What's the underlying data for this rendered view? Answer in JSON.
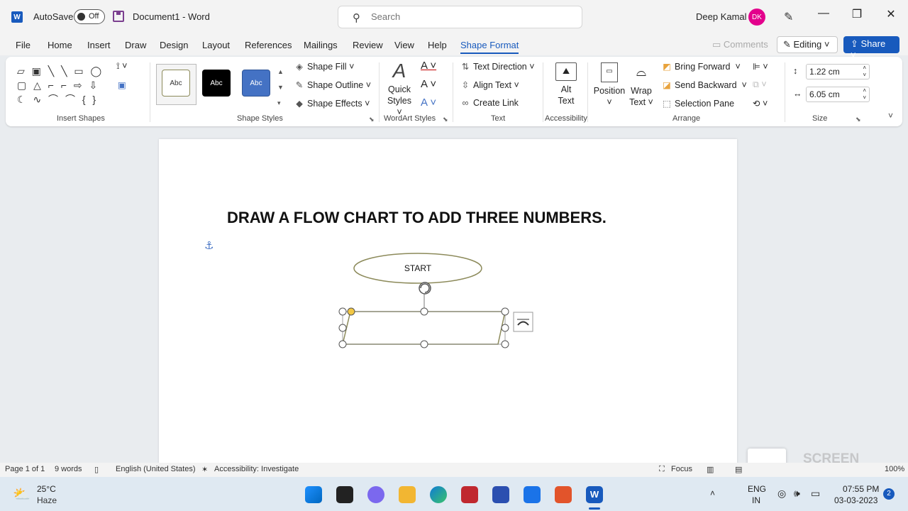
{
  "titlebar": {
    "logo": "W",
    "autosave_label": "AutoSave",
    "autosave_state": "Off",
    "doc_title": "Document1  -  Word",
    "search_placeholder": "Search",
    "user_name": "Deep Kamal",
    "user_initials": "DK",
    "minimize": "—",
    "restore": "❐",
    "close": "✕"
  },
  "tabs": [
    "File",
    "Home",
    "Insert",
    "Draw",
    "Design",
    "Layout",
    "References",
    "Mailings",
    "Review",
    "View",
    "Help",
    "Shape Format"
  ],
  "actions": {
    "comments": "Comments",
    "editing": "Editing",
    "share": "Share"
  },
  "ribbon": {
    "groups": {
      "insert_shapes": "Insert Shapes",
      "shape_styles": "Shape Styles",
      "wordart_styles": "WordArt Styles",
      "text": "Text",
      "accessibility": "Accessibility",
      "arrange": "Arrange",
      "size": "Size"
    },
    "style_presets": [
      "Abc",
      "Abc",
      "Abc"
    ],
    "shape_fill": "Shape Fill",
    "shape_outline": "Shape Outline",
    "shape_effects": "Shape Effects",
    "quick_styles_1": "Quick",
    "quick_styles_2": "Styles",
    "text_direction": "Text Direction",
    "align_text": "Align Text",
    "create_link": "Create Link",
    "alt_text_1": "Alt",
    "alt_text_2": "Text",
    "position": "Position",
    "wrap_text_1": "Wrap",
    "wrap_text_2": "Text",
    "bring_forward": "Bring Forward",
    "send_backward": "Send Backward",
    "selection_pane": "Selection Pane",
    "height": "1.22 cm",
    "width": "6.05 cm"
  },
  "document": {
    "heading": "DRAW A FLOW CHART TO ADD THREE NUMBERS.",
    "start_label": "START"
  },
  "status": {
    "page": "Page 1 of 1",
    "words": "9 words",
    "language": "English (United States)",
    "accessibility": "Accessibility: Investigate",
    "focus": "Focus",
    "zoom": "100%"
  },
  "watermark": "SCREEN RECORDER",
  "taskbar": {
    "temp": "25°C",
    "weather": "Haze",
    "lang_1": "ENG",
    "lang_2": "IN",
    "time": "07:55 PM",
    "date": "03-03-2023",
    "notifications": "2"
  },
  "colors": {
    "accent": "#185abd",
    "avatar": "#e3008c",
    "oval_outline": "#8c8a5a",
    "handle_yellow": "#f2c744"
  }
}
